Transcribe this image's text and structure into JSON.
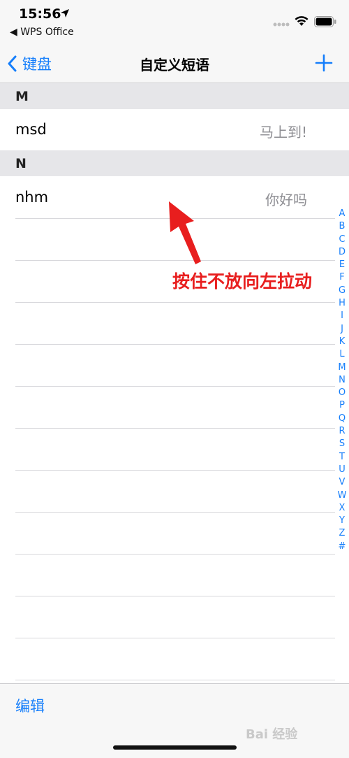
{
  "status_bar": {
    "time": "15:56",
    "back_app": "◀ WPS Office"
  },
  "nav": {
    "back_label": "键盘",
    "title": "自定义短语",
    "add_icon": "plus-icon"
  },
  "sections": [
    {
      "letter": "M",
      "rows": [
        {
          "phrase": "msd",
          "shortcut": "马上到!"
        }
      ]
    },
    {
      "letter": "N",
      "rows": [
        {
          "phrase": "nhm",
          "shortcut": "你好吗"
        }
      ]
    }
  ],
  "index_letters": [
    "A",
    "B",
    "C",
    "D",
    "E",
    "F",
    "G",
    "H",
    "I",
    "J",
    "K",
    "L",
    "M",
    "N",
    "O",
    "P",
    "Q",
    "R",
    "S",
    "T",
    "U",
    "V",
    "W",
    "X",
    "Y",
    "Z",
    "#"
  ],
  "annotation": "按住不放向左拉动",
  "toolbar": {
    "edit_label": "编辑"
  },
  "watermark": "Bai 经验",
  "colors": {
    "accent": "#157efb",
    "annotation": "#e81e1e",
    "section_bg": "#e6e6e9"
  }
}
